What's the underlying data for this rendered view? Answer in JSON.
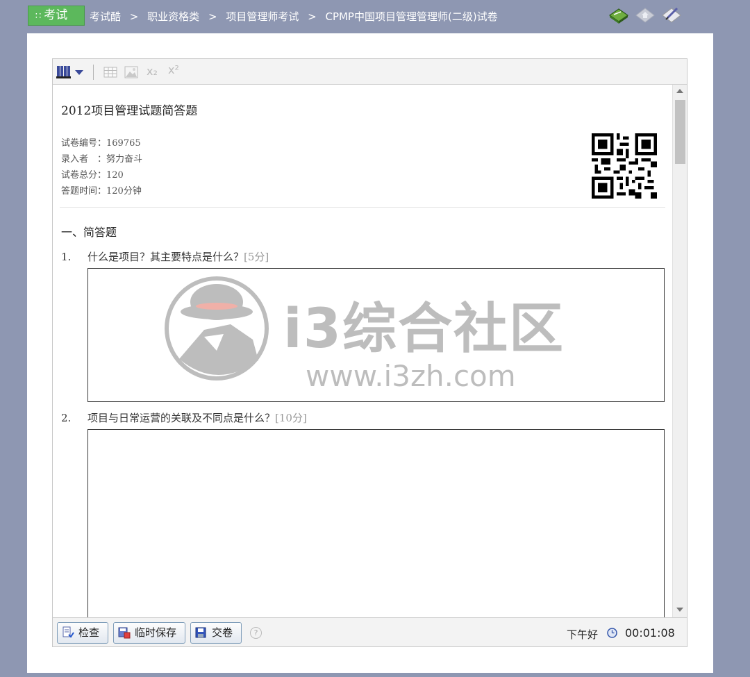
{
  "header": {
    "brand": "考试",
    "breadcrumb": [
      "考试酷",
      ">",
      "职业资格类",
      ">",
      "项目管理师考试",
      ">",
      "CPMP中国项目管理管理师(二级)试卷"
    ],
    "icons": [
      "book-icon",
      "home-icon",
      "edit-icon"
    ]
  },
  "toolbar": {
    "items": [
      "library-icon",
      "dropdown-icon",
      "table-icon",
      "image-icon",
      "subscript-icon",
      "superscript-icon"
    ],
    "subscript": "x₂",
    "superscript": "x²"
  },
  "paper": {
    "title": "2012项目管理试题简答题",
    "meta": [
      "试卷编号：169765",
      "录入者　：努力奋斗",
      "试卷总分：120",
      "答题时间：120分钟"
    ],
    "section": "一、简答题",
    "questions": [
      {
        "num": "1.",
        "text": "什么是项目？其主要特点是什么？",
        "score": "[5分]"
      },
      {
        "num": "2.",
        "text": "项目与日常运营的关联及不同点是什么？",
        "score": "[10分]"
      }
    ]
  },
  "watermark": {
    "title": "i3综合社区",
    "url": "www.i3zh.com"
  },
  "footer": {
    "check": "检查",
    "save": "临时保存",
    "submit": "交卷",
    "help": "?",
    "greeting": "下午好",
    "timer": "00:01:08"
  },
  "colors": {
    "background": "#8e97b2",
    "brand": "#5cb85c",
    "watermark": "#bdbdbd"
  }
}
